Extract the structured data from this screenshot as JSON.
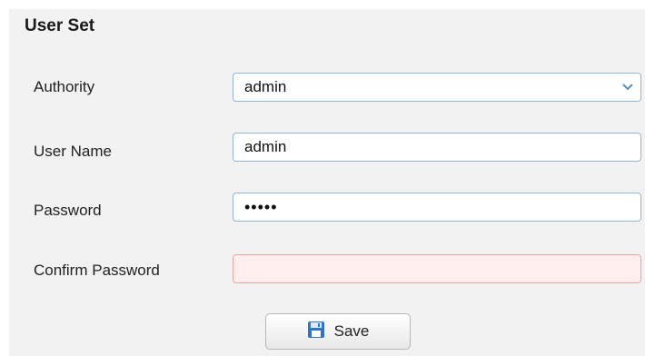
{
  "section": {
    "title": "User Set"
  },
  "form": {
    "authority": {
      "label": "Authority",
      "value": "admin"
    },
    "user_name": {
      "label": "User Name",
      "value": "admin"
    },
    "password": {
      "label": "Password",
      "value": "•••••"
    },
    "confirm_password": {
      "label": "Confirm Password",
      "value": ""
    }
  },
  "actions": {
    "save_label": "Save"
  },
  "colors": {
    "field_border": "#8fb7d9",
    "error_bg": "#ffeeee",
    "error_border": "#f0a1a1",
    "panel_bg": "#f2f2f2"
  },
  "icons": {
    "authority_dropdown": "chevron-down-icon",
    "save": "floppy-disk-icon"
  }
}
